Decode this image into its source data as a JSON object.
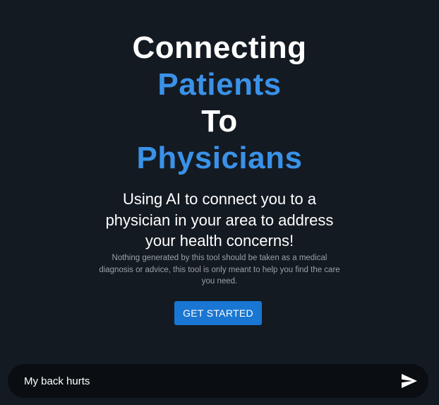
{
  "hero": {
    "line1": "Connecting",
    "line2": "Patients",
    "line3": "To",
    "line4": "Physicians",
    "subtitle": "Using AI to connect you to a physician in your area to address your health concerns!",
    "disclaimer": "Nothing generated by this tool should be taken as a medical diagnosis or advice, this tool is only meant to help you find the care you need."
  },
  "cta": {
    "label": "GET STARTED"
  },
  "chat": {
    "input_value": "My back hurts",
    "send_icon": "send-icon"
  },
  "colors": {
    "background": "#141a22",
    "accent_blue": "#3a92e8",
    "button_blue": "#1976d2",
    "chat_bar": "#0a0e12",
    "disclaimer_text": "#9aa0a8"
  }
}
